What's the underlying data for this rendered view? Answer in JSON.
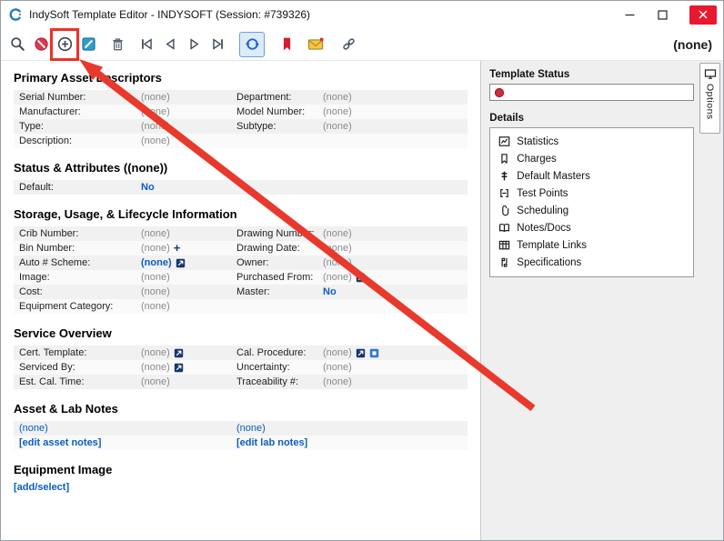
{
  "window": {
    "title": "IndySoft Template Editor - INDYSOFT (Session: #739326)"
  },
  "toolbar": {
    "record_indicator": "(none)"
  },
  "main": {
    "primary": {
      "title": "Primary Asset Descriptors",
      "rows": [
        {
          "l1": "Serial Number:",
          "v1": "(none)",
          "l2": "Department:",
          "v2": "(none)"
        },
        {
          "l1": "Manufacturer:",
          "v1": "(none)",
          "l2": "Model Number:",
          "v2": "(none)"
        },
        {
          "l1": "Type:",
          "v1": "(none)",
          "l2": "Subtype:",
          "v2": "(none)"
        },
        {
          "l1": "Description:",
          "v1": "(none)"
        }
      ]
    },
    "status": {
      "title": "Status & Attributes ((none))",
      "rows": [
        {
          "l1": "Default:",
          "v1": "No"
        }
      ]
    },
    "storage": {
      "title": "Storage, Usage, & Lifecycle Information",
      "rows": [
        {
          "l1": "Crib Number:",
          "v1": "(none)",
          "l2": "Drawing Number:",
          "v2": "(none)"
        },
        {
          "l1": "Bin Number:",
          "v1": "(none)",
          "l2": "Drawing Date:",
          "v2": "(none)"
        },
        {
          "l1": "Auto # Scheme:",
          "v1": "(none)",
          "l2": "Owner:",
          "v2": "(none)"
        },
        {
          "l1": "Image:",
          "v1": "(none)",
          "l2": "Purchased From:",
          "v2": "(none)"
        },
        {
          "l1": "Cost:",
          "v1": "(none)",
          "l2": "Master:",
          "v2": "No"
        },
        {
          "l1": "Equipment Category:",
          "v1": "(none)"
        }
      ]
    },
    "service": {
      "title": "Service Overview",
      "rows": [
        {
          "l1": "Cert. Template:",
          "v1": "(none)",
          "l2": "Cal. Procedure:",
          "v2": "(none)"
        },
        {
          "l1": "Serviced By:",
          "v1": "(none)",
          "l2": "Uncertainty:",
          "v2": "(none)"
        },
        {
          "l1": "Est. Cal. Time:",
          "v1": "(none)",
          "l2": "Traceability #:",
          "v2": "(none)"
        }
      ]
    },
    "notes": {
      "title": "Asset & Lab Notes",
      "asset_value": "(none)",
      "lab_value": "(none)",
      "asset_link": "[edit asset notes]",
      "lab_link": "[edit lab notes]"
    },
    "image": {
      "title": "Equipment Image",
      "link": "[add/select]"
    }
  },
  "panel": {
    "template_status_label": "Template Status",
    "details_label": "Details",
    "details_items": [
      "Statistics",
      "Charges",
      "Default Masters",
      "Test Points",
      "Scheduling",
      "Notes/Docs",
      "Template Links",
      "Specifications"
    ],
    "options_tab_label": "Options"
  },
  "icons": {
    "toolbar": [
      "search-icon",
      "clear-record-icon",
      "add-record-icon",
      "edit-record-icon",
      "delete-record-icon",
      "nav-first-icon",
      "nav-prev-icon",
      "nav-next-icon",
      "nav-last-icon",
      "refresh-icon",
      "bookmark-icon",
      "email-icon",
      "link-icon"
    ],
    "details": [
      "statistics-icon",
      "charges-icon",
      "default-masters-icon",
      "test-points-icon",
      "scheduling-icon",
      "notes-docs-icon",
      "template-links-icon",
      "specifications-icon"
    ]
  },
  "colors": {
    "annotation_red": "#ee3124",
    "link_blue": "#0a5dc2",
    "bookmark_red": "#d2202f",
    "refresh_blue": "#2063c6"
  },
  "annotation": {
    "description": "red arrow and box highlighting the add button"
  }
}
